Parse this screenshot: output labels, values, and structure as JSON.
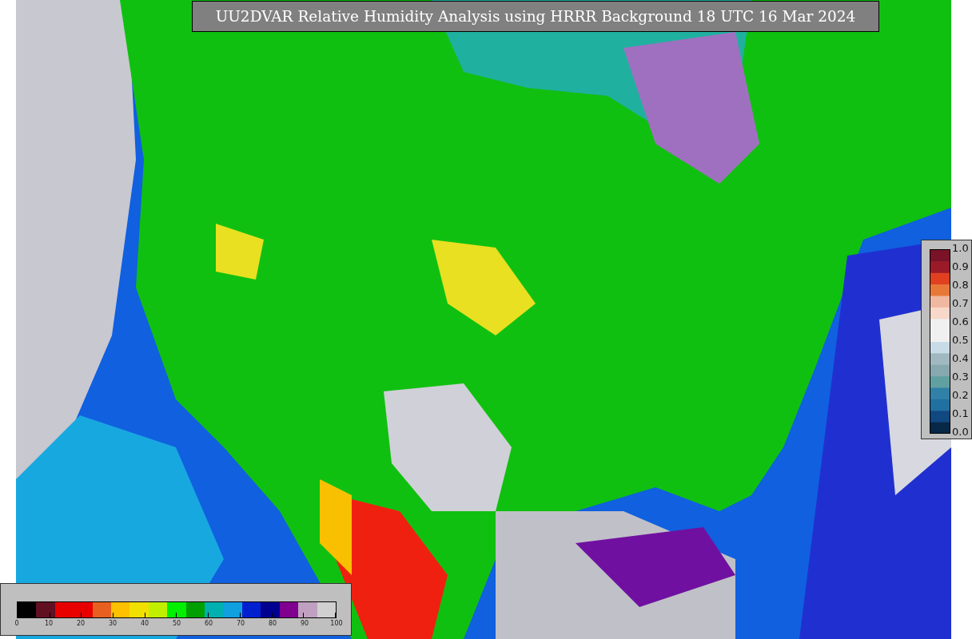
{
  "title": "UU2DVAR Relative Humidity Analysis using HRRR Background 18 UTC 16 Mar 2024",
  "horizontal_colorbar": {
    "ticks": [
      "0",
      "10",
      "20",
      "30",
      "40",
      "50",
      "60",
      "70",
      "80",
      "90",
      "100"
    ]
  },
  "vertical_colorbar": {
    "ticks": [
      "1.0",
      "0.9",
      "0.8",
      "0.7",
      "0.6",
      "0.5",
      "0.4",
      "0.3",
      "0.2",
      "0.1",
      "0.0"
    ]
  }
}
